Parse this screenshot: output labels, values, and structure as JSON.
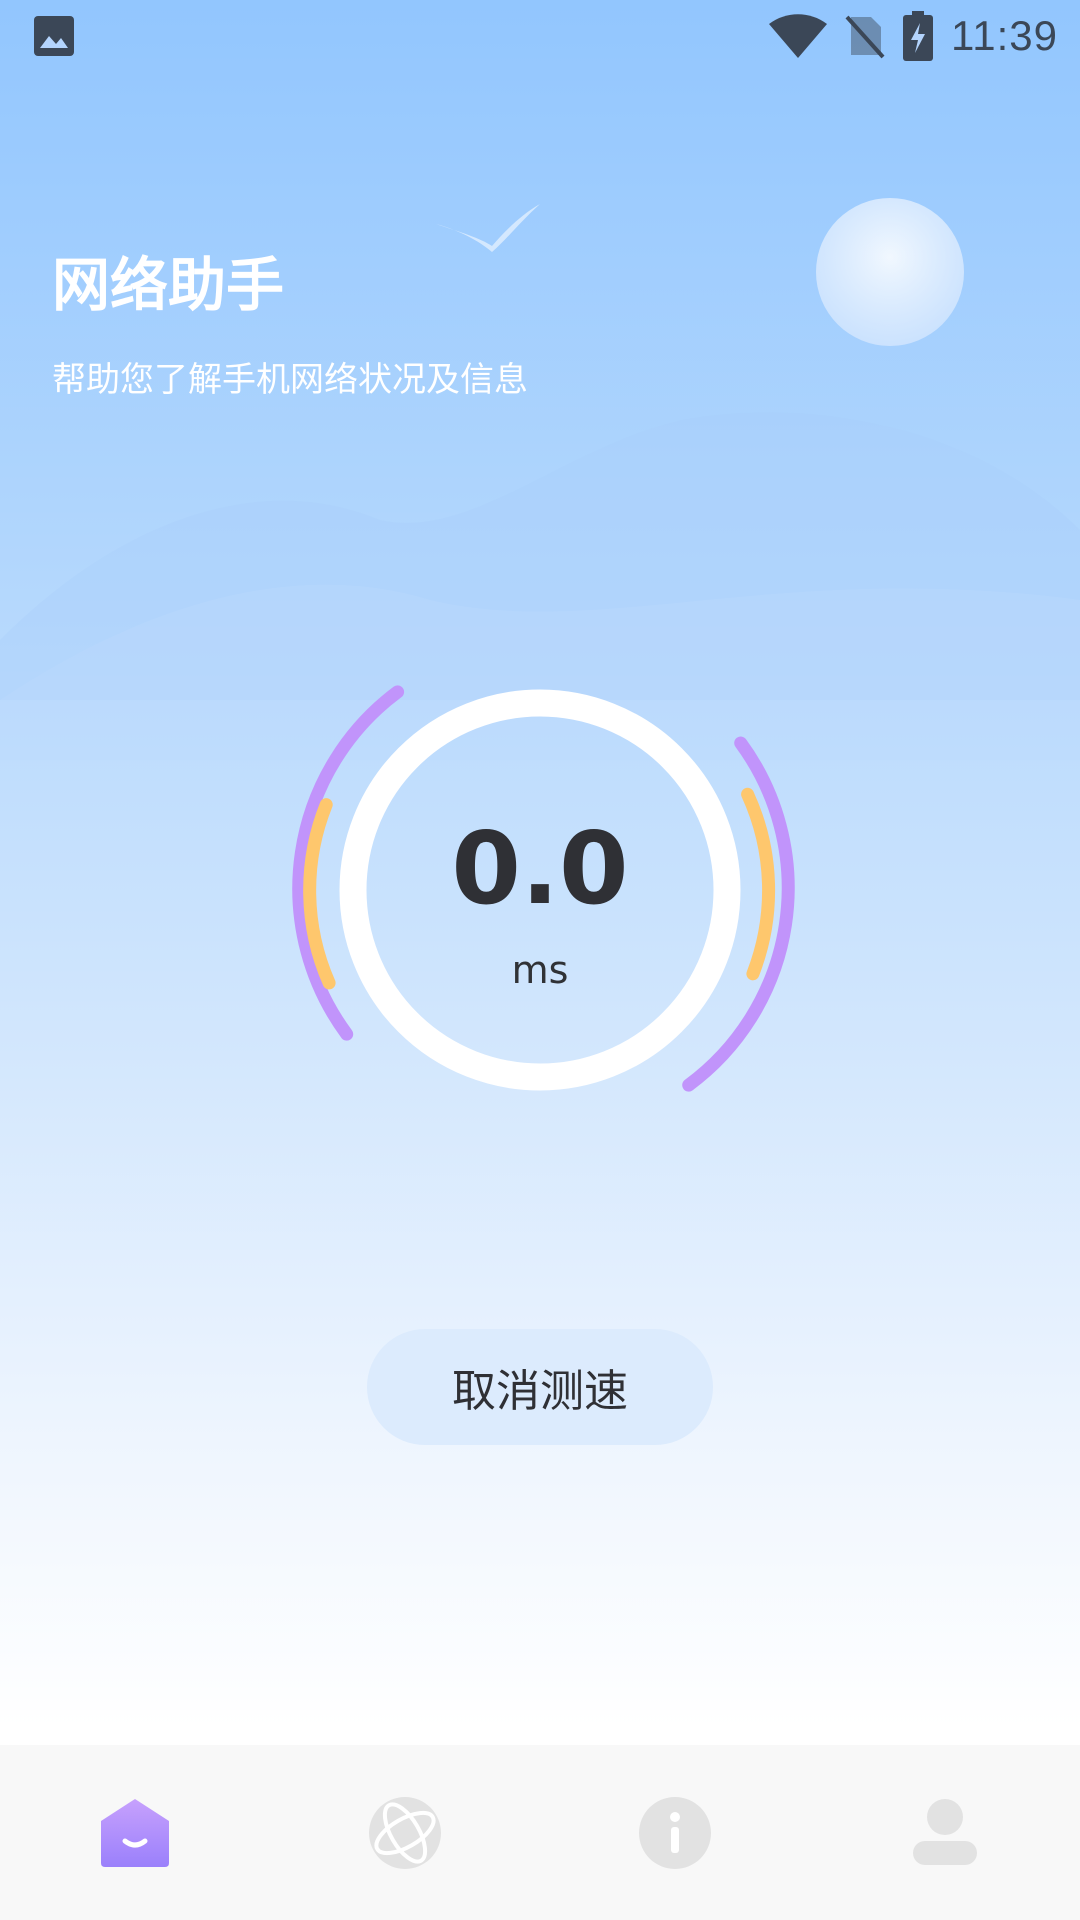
{
  "status_bar": {
    "time": "11:39"
  },
  "header": {
    "title": "网络助手",
    "subtitle": "帮助您了解手机网络状况及信息"
  },
  "gauge": {
    "value": "0.0",
    "unit": "ms"
  },
  "actions": {
    "cancel_label": "取消测速"
  },
  "bottom_nav": {
    "items": [
      {
        "icon": "home-icon",
        "active": true
      },
      {
        "icon": "globe-icon",
        "active": false
      },
      {
        "icon": "info-icon",
        "active": false
      },
      {
        "icon": "user-icon",
        "active": false
      }
    ]
  },
  "colors": {
    "accent_purple": "#c194fb",
    "accent_orange": "#fec76d",
    "nav_active": "#a983fb",
    "nav_inactive": "#e2e2e2"
  }
}
